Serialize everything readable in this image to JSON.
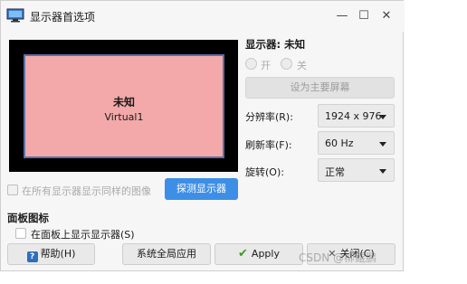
{
  "window": {
    "title": "显示器首选项",
    "icon": "display-settings-icon"
  },
  "preview": {
    "monitor_name": "未知",
    "monitor_sub": "Virtual1",
    "monitor_color": "#f3a9a9",
    "border_color": "#5a6fa8"
  },
  "settings": {
    "display_label": "显示器: 未知",
    "on_label": "开",
    "off_label": "关",
    "set_primary_label": "设为主要屏幕",
    "resolution_label": "分辨率(R):",
    "resolution_value": "1924 x 976",
    "refresh_label": "刷新率(F):",
    "refresh_value": "60 Hz",
    "rotation_label": "旋转(O):",
    "rotation_value": "正常"
  },
  "mirror": {
    "checkbox_label": "在所有显示器显示同样的图像",
    "detect_button": "探测显示器"
  },
  "panel": {
    "heading": "面板图标",
    "show_in_panel_label": "在面板上显示显示器(S)"
  },
  "footer": {
    "help_label": "帮助(H)",
    "apply_global_label": "系统全局应用",
    "apply_label": "Apply",
    "close_label": "关闭(C)"
  },
  "watermark": "CSDN @柳鲲鹏",
  "colors": {
    "accent": "#3d8ee6",
    "preview_bg": "#000000"
  }
}
